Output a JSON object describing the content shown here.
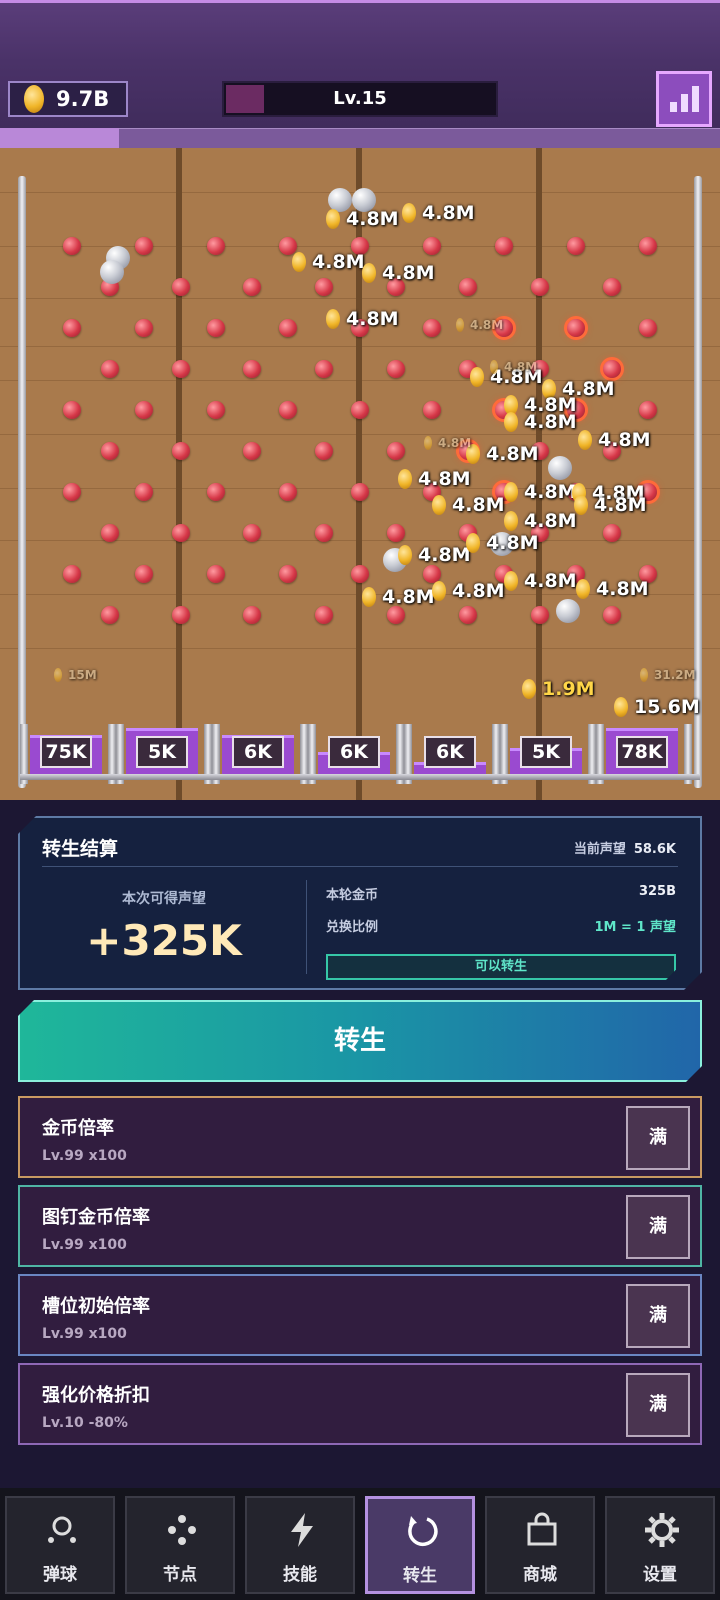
{
  "header": {
    "coins": "9.7B",
    "level_label": "Lv.15",
    "level_progress": 0.14,
    "xp_progress": 0.165,
    "stats_button_icon": "bar-chart-icon"
  },
  "board": {
    "popups": [
      {
        "text": "4.8M"
      },
      {
        "text": "4.8M"
      },
      {
        "text": "4.8M"
      },
      {
        "text": "4.8M"
      },
      {
        "text": "4.8M"
      },
      {
        "text": "4.8M"
      },
      {
        "text": "4.8M"
      },
      {
        "text": "4.8M"
      },
      {
        "text": "4.8M"
      },
      {
        "text": "4.8M"
      },
      {
        "text": "4.8M"
      },
      {
        "text": "4.8M"
      },
      {
        "text": "4.8M"
      },
      {
        "text": "4.8M"
      },
      {
        "text": "4.8M"
      },
      {
        "text": "4.8M"
      },
      {
        "text": "4.8M"
      },
      {
        "text": "4.8M"
      },
      {
        "text": "4.8M"
      },
      {
        "text": "4.8M"
      },
      {
        "text": "4.8M"
      },
      {
        "text": "4.8M"
      },
      {
        "text": "4.8M"
      }
    ],
    "slot_popups": [
      {
        "text": "1.9M"
      },
      {
        "text": "15.6M"
      }
    ],
    "faint_popups": [
      {
        "text": "15M"
      },
      {
        "text": "4.8M"
      },
      {
        "text": "4.8M"
      },
      {
        "text": "4.8M"
      },
      {
        "text": "31.2M"
      }
    ],
    "slots": [
      {
        "label": "75K",
        "fill": 0.82
      },
      {
        "label": "5K",
        "fill": 0.95
      },
      {
        "label": "6K",
        "fill": 0.82
      },
      {
        "label": "6K",
        "fill": 0.45
      },
      {
        "label": "6K",
        "fill": 0.25
      },
      {
        "label": "5K",
        "fill": 0.55
      },
      {
        "label": "78K",
        "fill": 0.95
      }
    ]
  },
  "rebirth_panel": {
    "title": "转生结算",
    "current_prestige_label": "当前声望",
    "current_prestige_value": "58.6K",
    "gain_label": "本次可得声望",
    "gain_value": "+325K",
    "round_coins_label": "本轮金币",
    "round_coins_value": "325B",
    "ratio_label": "兑换比例",
    "ratio_value": "1M = 1 声望",
    "ready_label": "可以转生"
  },
  "rebirth_button": "转生",
  "upgrades": [
    {
      "name": "金币倍率",
      "detail": "Lv.99  x100",
      "button": "满",
      "border": "#c89a62"
    },
    {
      "name": "图钉金币倍率",
      "detail": "Lv.99  x100",
      "button": "满",
      "border": "#4fb5a4"
    },
    {
      "name": "槽位初始倍率",
      "detail": "Lv.99  x100",
      "button": "满",
      "border": "#6a86c2"
    },
    {
      "name": "强化价格折扣",
      "detail": "Lv.10  -80%",
      "button": "满",
      "border": "#8e68b6"
    }
  ],
  "nav": [
    {
      "label": "弹球",
      "icon": "ball-drop-icon"
    },
    {
      "label": "节点",
      "icon": "nodes-icon"
    },
    {
      "label": "技能",
      "icon": "lightning-icon"
    },
    {
      "label": "转生",
      "icon": "rebirth-icon",
      "active": true
    },
    {
      "label": "商城",
      "icon": "shop-bag-icon"
    },
    {
      "label": "设置",
      "icon": "gear-icon"
    }
  ]
}
